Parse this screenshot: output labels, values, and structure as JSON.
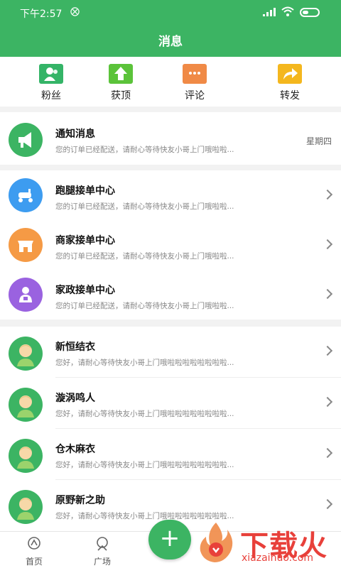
{
  "status_bar": {
    "time": "下午2:57",
    "dnd_glyph": "⨂"
  },
  "page": {
    "title": "消息"
  },
  "quick_actions": [
    {
      "label": "粉丝",
      "icon": "fans-icon",
      "color": "#34b467"
    },
    {
      "label": "获顶",
      "icon": "upvote-icon",
      "color": "#5bc33a"
    },
    {
      "label": "评论",
      "icon": "comment-icon",
      "color": "#f08a46"
    },
    {
      "label": "转发",
      "icon": "forward-icon",
      "color": "#f4b71e"
    }
  ],
  "notice": {
    "title": "通知消息",
    "subtitle": "您的订单已经配送，请耐心等待快友小哥上门哦啦啦...",
    "time": "星期四",
    "icon": "megaphone-icon",
    "color": "#3cb463"
  },
  "centers": [
    {
      "title": "跑腿接单中心",
      "subtitle": "您的订单已经配送，请耐心等待快友小哥上门哦啦啦...",
      "icon": "scooter-icon",
      "color": "#3d9cf0"
    },
    {
      "title": "商家接单中心",
      "subtitle": "您的订单已经配送，请耐心等待快友小哥上门哦啦啦...",
      "icon": "shop-icon",
      "color": "#f59a45"
    },
    {
      "title": "家政接单中心",
      "subtitle": "您的订单已经配送，请耐心等待快友小哥上门哦啦啦...",
      "icon": "housekeeper-icon",
      "color": "#9a62e0"
    }
  ],
  "chats": [
    {
      "title": "新恒结衣",
      "subtitle": "您好，请耐心等待快友小哥上门哦啦啦啦啦啦啦啦啦..."
    },
    {
      "title": "漩涡鸣人",
      "subtitle": "您好，请耐心等待快友小哥上门哦啦啦啦啦啦啦啦啦..."
    },
    {
      "title": "仓木麻衣",
      "subtitle": "您好，请耐心等待快友小哥上门哦啦啦啦啦啦啦啦啦..."
    },
    {
      "title": "原野新之助",
      "subtitle": "您好，请耐心等待快友小哥上门哦啦啦啦啦啦啦啦啦..."
    }
  ],
  "tabbar": {
    "home": "首页",
    "plaza": "广场",
    "fab_glyph": "+"
  },
  "watermark": {
    "text": "下载火",
    "url": "xiazaihuo.com"
  },
  "colors": {
    "brand_green": "#3cb463",
    "watermark_red": "#e8403a"
  }
}
